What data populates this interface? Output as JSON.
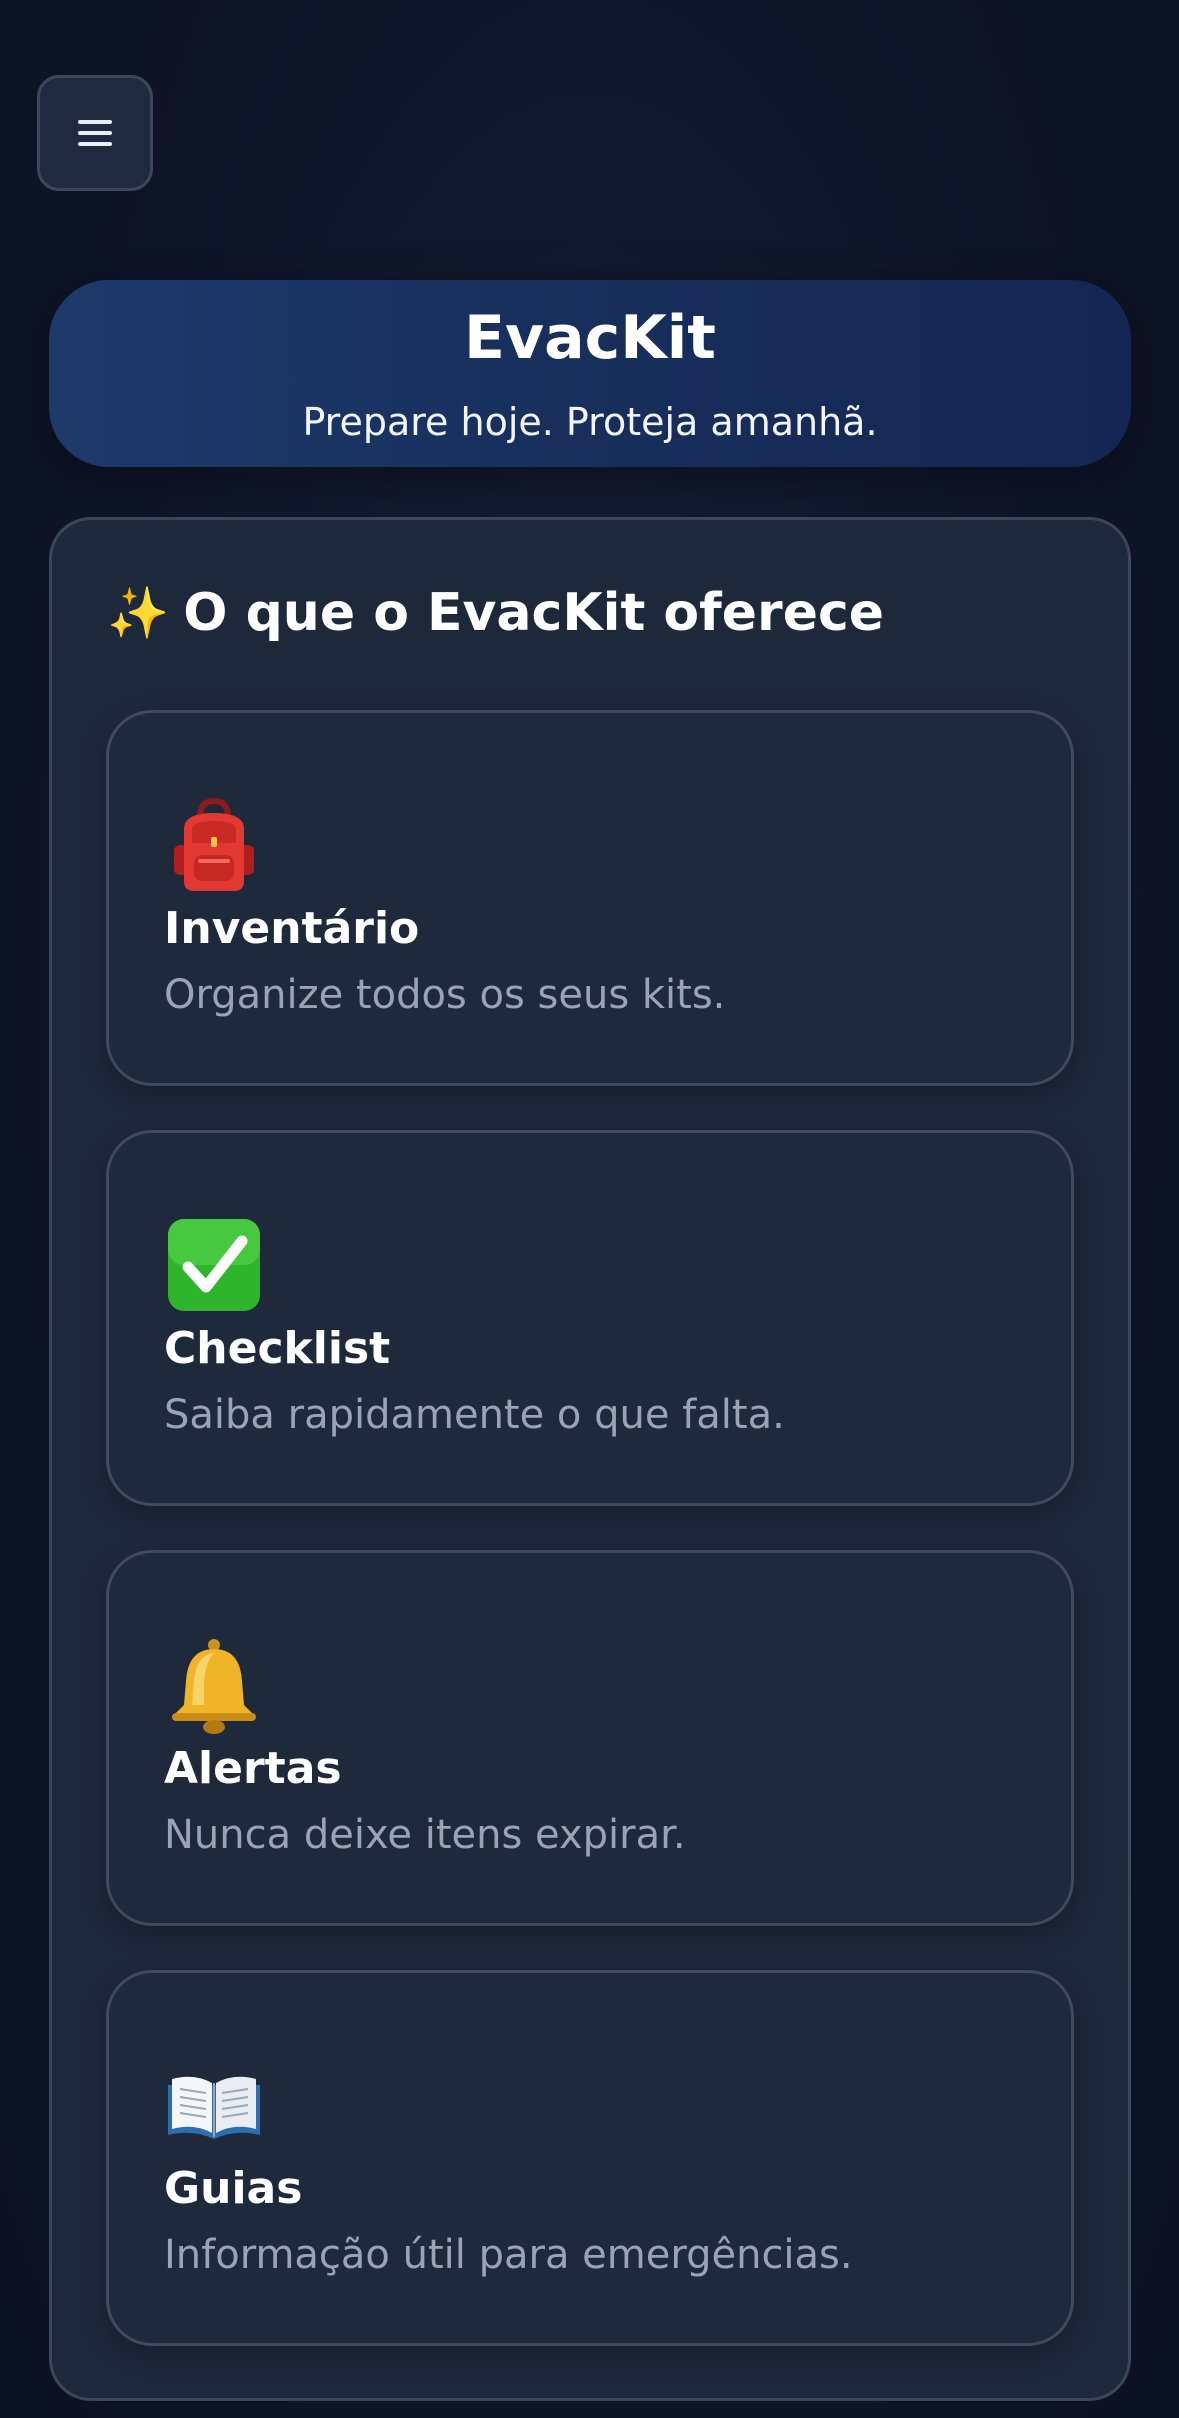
{
  "header": {
    "menu_icon": "hamburger-menu-icon"
  },
  "hero": {
    "title": "EvacKit",
    "subtitle": "Prepare hoje. Proteja amanhã."
  },
  "features": {
    "heading_icon": "✨",
    "heading": "O que o EvacKit oferece",
    "items": [
      {
        "icon": "backpack-icon",
        "title": "Inventário",
        "description": "Organize todos os seus kits."
      },
      {
        "icon": "check-mark-icon",
        "title": "Checklist",
        "description": "Saiba rapidamente o que falta."
      },
      {
        "icon": "bell-icon",
        "title": "Alertas",
        "description": "Nunca deixe itens expirar."
      },
      {
        "icon": "open-book-icon",
        "title": "Guias",
        "description": "Informação útil para emergências."
      }
    ]
  },
  "colors": {
    "background": "#0e1527",
    "hero_gradient_start": "#1d3a6b",
    "hero_gradient_end": "#142654",
    "panel": "#1e283b",
    "card_border": "#3d4a5f",
    "muted_text": "#9aa3b4"
  }
}
